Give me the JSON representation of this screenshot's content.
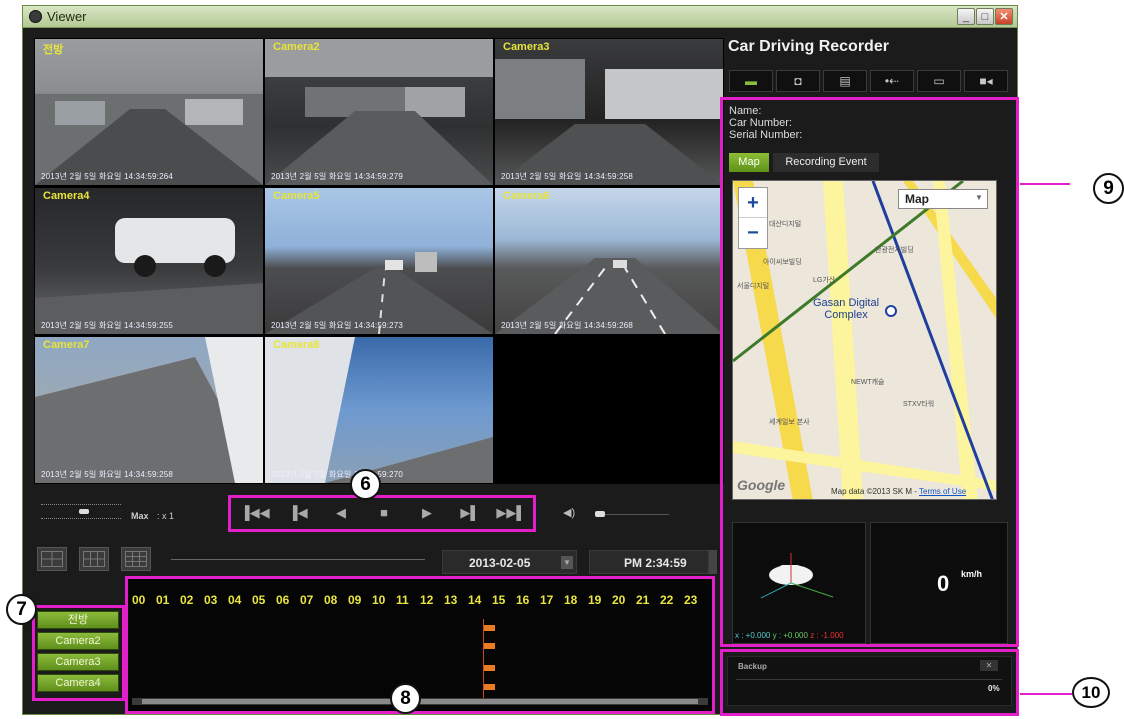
{
  "window": {
    "title": "Viewer",
    "minimize": "_",
    "maximize": "□",
    "close": "✕"
  },
  "cameras": [
    {
      "name": "전방",
      "timestamp": "2013년 2월 5일 화요일 14:34:59:264"
    },
    {
      "name": "Camera2",
      "timestamp": "2013년 2월 5일 화요일 14:34:59:279"
    },
    {
      "name": "Camera3",
      "timestamp": "2013년 2월 5일 화요일 14:34:59:258"
    },
    {
      "name": "Camera4",
      "timestamp": "2013년 2월 5일 화요일 14:34:59:255"
    },
    {
      "name": "Camera5",
      "timestamp": "2013년 2월 5일 화요일 14:34:59:273"
    },
    {
      "name": "Camera6",
      "timestamp": "2013년 2월 5일 화요일 14:34:59:268"
    },
    {
      "name": "Camera7",
      "timestamp": "2013년 2월 5일 화요일 14:34:59:258"
    },
    {
      "name": "Camera8",
      "timestamp": "2013년 2월 5일 화요일 14:34:59:270"
    }
  ],
  "speed": {
    "max_label": "Max",
    "value_label": ": x 1"
  },
  "playback": {
    "first": "▐◀◀",
    "prev": "▐◀",
    "rewind": "◀",
    "stop": "■",
    "play": "▶",
    "next": "▶▌",
    "last": "▶▶▌"
  },
  "volume": {
    "icon": "speaker-icon",
    "glyph": "◀)"
  },
  "date": {
    "value": "2013-02-05",
    "time": "PM 2:34:59"
  },
  "timeline": {
    "hours": [
      "00",
      "01",
      "02",
      "03",
      "04",
      "05",
      "06",
      "07",
      "08",
      "09",
      "10",
      "11",
      "12",
      "13",
      "14",
      "15",
      "16",
      "17",
      "18",
      "19",
      "20",
      "21",
      "22",
      "23"
    ],
    "cursor_hour": 14.6,
    "cameras": [
      "전방",
      "Camera2",
      "Camera3",
      "Camera4"
    ]
  },
  "callouts": {
    "c6": "6",
    "c7": "7",
    "c8": "8",
    "c9": "9",
    "c10": "10"
  },
  "side": {
    "title": "Car Driving Recorder",
    "toolbar": [
      "folder-icon",
      "camera-icon",
      "print-icon",
      "usb-icon",
      "monitor-icon",
      "video-camera-icon"
    ],
    "info": {
      "name": "Name:",
      "car_number": "Car Number:",
      "serial_number": "Serial Number:"
    },
    "tabs": [
      "Map",
      "Recording Event"
    ],
    "map": {
      "zoom_in": "+",
      "zoom_out": "−",
      "type": "Map",
      "labels": [
        "Gasan Digital",
        "Complex"
      ],
      "attribution_logo": "Google",
      "attribution": "Map data ©2013 SK M -",
      "terms": "Terms of Use"
    },
    "gsensor": {
      "x_label": "x : +0.000",
      "y_label": "y : +0.000",
      "z_label": "z : -1.000"
    },
    "speed": {
      "value": "0",
      "unit": "km/h"
    },
    "backup": {
      "label": "Backup",
      "progress": "0%",
      "progress_value": 0
    }
  }
}
